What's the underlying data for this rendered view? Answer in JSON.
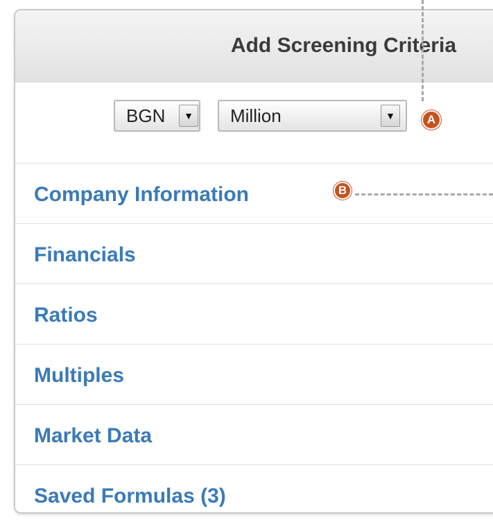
{
  "panel": {
    "title": "Add Screening Criteria",
    "currency_select": {
      "value": "BGN"
    },
    "unit_select": {
      "value": "Million"
    },
    "categories": [
      {
        "label": "Company Information"
      },
      {
        "label": "Financials"
      },
      {
        "label": "Ratios"
      },
      {
        "label": "Multiples"
      },
      {
        "label": "Market Data"
      },
      {
        "label": "Saved Formulas (3)"
      }
    ]
  },
  "callouts": {
    "a": "A",
    "b": "B"
  },
  "colors": {
    "link": "#3a7ab8",
    "badge": "#c5521e",
    "title": "#3a3a3a"
  }
}
